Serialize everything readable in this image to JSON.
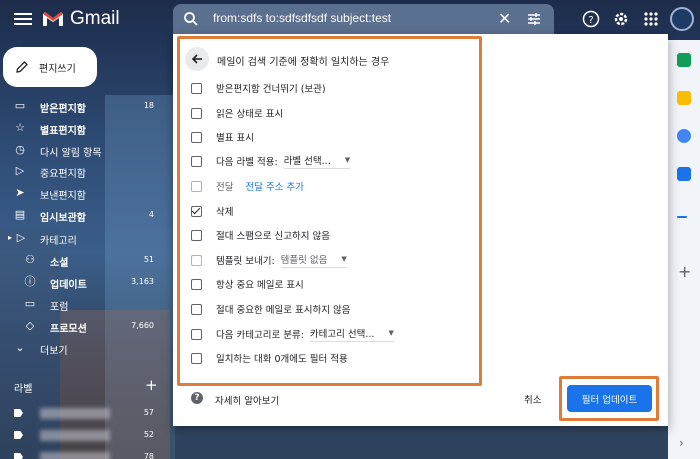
{
  "app": {
    "name": "Gmail"
  },
  "search": {
    "query": "from:sdfs to:sdfsdfsdf subject:test"
  },
  "compose": {
    "label": "편지쓰기"
  },
  "sidebar": {
    "items": [
      {
        "label": "받은편지함",
        "count": "18",
        "icon": "inbox-icon",
        "bold": true
      },
      {
        "label": "별표편지함",
        "count": "",
        "icon": "star-icon",
        "bold": false
      },
      {
        "label": "다시 알림 항목",
        "count": "",
        "icon": "clock-icon",
        "bold": false
      },
      {
        "label": "중요편지함",
        "count": "",
        "icon": "important-icon",
        "bold": false
      },
      {
        "label": "보낸편지함",
        "count": "",
        "icon": "send-icon",
        "bold": false
      },
      {
        "label": "임시보관함",
        "count": "4",
        "icon": "draft-icon",
        "bold": true
      },
      {
        "label": "카테고리",
        "count": "",
        "icon": "category-icon",
        "bold": false
      },
      {
        "label": "소셜",
        "count": "51",
        "icon": "people-icon",
        "bold": true
      },
      {
        "label": "업데이트",
        "count": "3,163",
        "icon": "info-icon",
        "bold": true
      },
      {
        "label": "포럼",
        "count": "",
        "icon": "forum-icon",
        "bold": false
      },
      {
        "label": "프로모션",
        "count": "7,660",
        "icon": "promo-tag-icon",
        "bold": true
      },
      {
        "label": "더보기",
        "count": "",
        "icon": "chevron-down-icon",
        "bold": false
      }
    ],
    "labels_heading": "라벨",
    "label_counts": [
      "57",
      "52",
      "78"
    ]
  },
  "dialog": {
    "title": "메일이 검색 기준에 정확히 일치하는 경우",
    "options": [
      {
        "label": "받은편지함 건너뛰기 (보관)",
        "checked": false,
        "disabled": false
      },
      {
        "label": "읽은 상태로 표시",
        "checked": false,
        "disabled": false
      },
      {
        "label": "별표 표시",
        "checked": false,
        "disabled": false
      },
      {
        "label": "다음 라벨 적용:",
        "checked": false,
        "disabled": false,
        "select": "라벨 선택..."
      },
      {
        "label": "전달",
        "checked": false,
        "disabled": true,
        "link": "전달 주소 추가"
      },
      {
        "label": "삭제",
        "checked": true,
        "disabled": false
      },
      {
        "label": "절대 스팸으로 신고하지 않음",
        "checked": false,
        "disabled": false
      },
      {
        "label": "템플릿 보내기:",
        "checked": false,
        "disabled": true,
        "select": "템플릿 없음"
      },
      {
        "label": "항상 중요 메일로 표시",
        "checked": false,
        "disabled": false
      },
      {
        "label": "절대 중요한 메일로 표시하지 않음",
        "checked": false,
        "disabled": false
      },
      {
        "label": "다음 카테고리로 분류:",
        "checked": false,
        "disabled": false,
        "select": "카테고리 선택..."
      },
      {
        "label": "일치하는 대화 0개에도 필터 적용",
        "checked": false,
        "disabled": false
      }
    ],
    "learn_more": "자세히 알아보기",
    "cancel": "취소",
    "update": "필터 업데이트"
  },
  "colors": {
    "accent": "#1a73e8",
    "highlight": "#e07b39",
    "gmail_red": "#ea4335"
  }
}
